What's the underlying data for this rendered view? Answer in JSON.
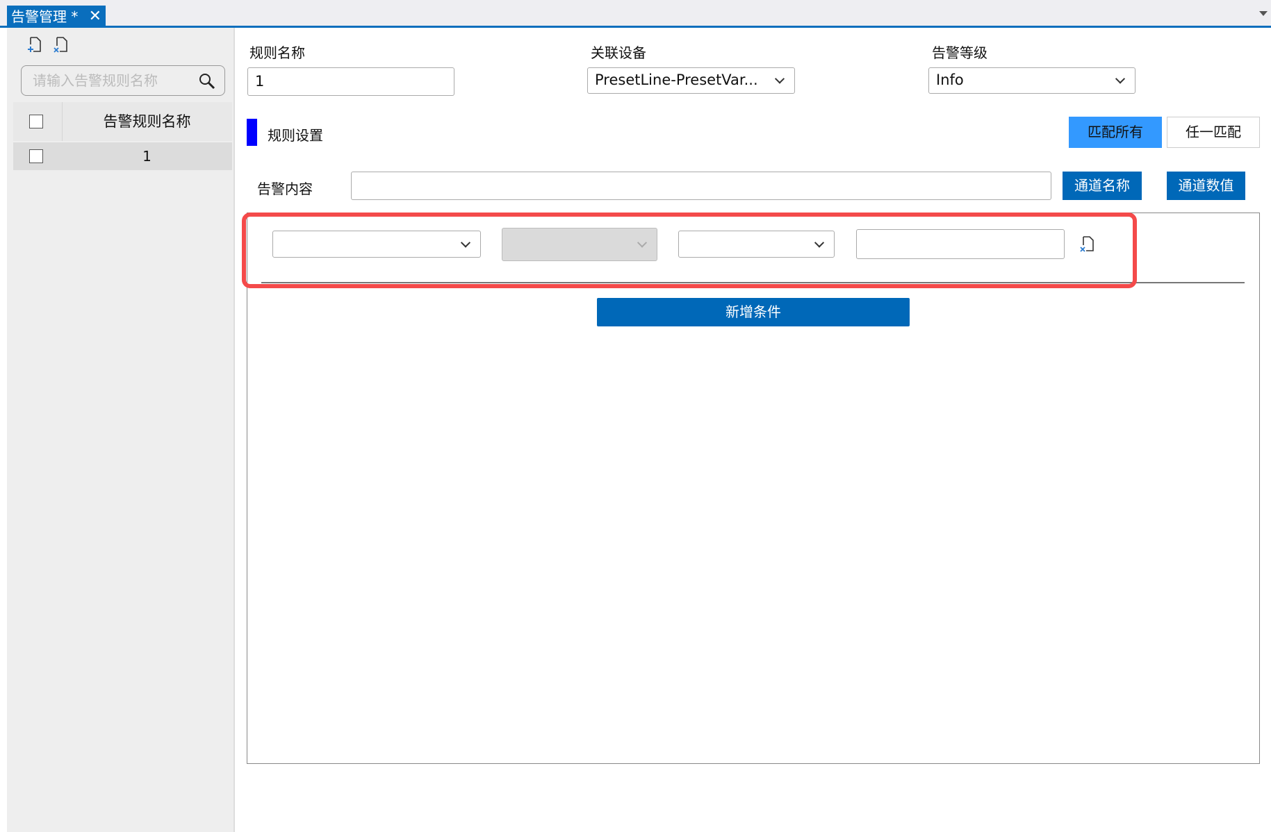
{
  "tab": {
    "title": "告警管理 *",
    "close": "✕"
  },
  "left": {
    "search_placeholder": "请输入告警规则名称",
    "column_header": "告警规则名称",
    "rows": [
      {
        "name": "1"
      }
    ]
  },
  "form": {
    "rule_name_label": "规则名称",
    "rule_name_value": "1",
    "device_label": "关联设备",
    "device_value": "PresetLine-PresetVar...",
    "level_label": "告警等级",
    "level_value": "Info"
  },
  "rules": {
    "section_title": "规则设置",
    "match_all": "匹配所有",
    "match_any": "任一匹配",
    "content_label": "告警内容",
    "content_value": "",
    "channel_name_btn": "通道名称",
    "channel_value_btn": "通道数值",
    "add_condition": "新增条件"
  },
  "colors": {
    "accent": "#0a6ebd",
    "match_all_bg": "#3399ff",
    "highlight": "#f44a4a",
    "section_bar": "#0000ff"
  }
}
